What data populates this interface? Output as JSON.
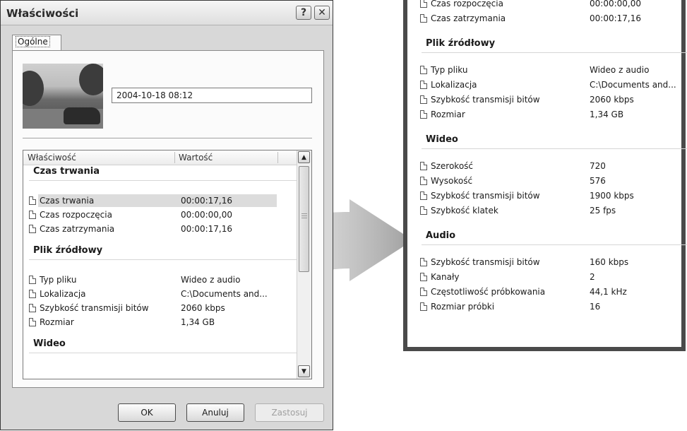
{
  "dialog": {
    "title": "Właściwości",
    "help_label": "?",
    "close_label": "✕",
    "tab_label": "Ogólne",
    "date": "2004-10-18 08:12",
    "columns": {
      "property": "Właściwość",
      "value": "Wartość"
    },
    "sections": [
      {
        "title": "Czas trwania",
        "rows": [
          {
            "k": "Czas trwania",
            "v": "00:00:17,16"
          },
          {
            "k": "Czas rozpoczęcia",
            "v": "00:00:00,00"
          },
          {
            "k": "Czas zatrzymania",
            "v": "00:00:17,16"
          }
        ]
      },
      {
        "title": "Plik źródłowy",
        "rows": [
          {
            "k": "Typ pliku",
            "v": "Wideo z audio"
          },
          {
            "k": "Lokalizacja",
            "v": "C:\\Documents and..."
          },
          {
            "k": "Szybkość transmisji bitów",
            "v": "2060 kbps"
          },
          {
            "k": "Rozmiar",
            "v": "1,34 GB"
          }
        ]
      },
      {
        "title": "Wideo",
        "rows": []
      }
    ],
    "buttons": {
      "ok": "OK",
      "cancel": "Anuluj",
      "apply": "Zastosuj"
    }
  },
  "continuation": {
    "top_rows": [
      {
        "k": "Czas rozpoczęcia",
        "v": "00:00:00,00"
      },
      {
        "k": "Czas zatrzymania",
        "v": "00:00:17,16"
      }
    ],
    "sections": [
      {
        "title": "Plik źródłowy",
        "rows": [
          {
            "k": "Typ pliku",
            "v": "Wideo z audio"
          },
          {
            "k": "Lokalizacja",
            "v": "C:\\Documents and..."
          },
          {
            "k": "Szybkość transmisji bitów",
            "v": "2060 kbps"
          },
          {
            "k": "Rozmiar",
            "v": "1,34 GB"
          }
        ]
      },
      {
        "title": "Wideo",
        "rows": [
          {
            "k": "Szerokość",
            "v": "720"
          },
          {
            "k": "Wysokość",
            "v": "576"
          },
          {
            "k": "Szybkość transmisji bitów",
            "v": "1900 kbps"
          },
          {
            "k": "Szybkość klatek",
            "v": "25 fps"
          }
        ]
      },
      {
        "title": "Audio",
        "rows": [
          {
            "k": "Szybkość transmisji bitów",
            "v": "160 kbps"
          },
          {
            "k": "Kanały",
            "v": "2"
          },
          {
            "k": "Częstotliwość próbkowania",
            "v": "44,1 kHz"
          },
          {
            "k": "Rozmiar próbki",
            "v": "16"
          }
        ]
      }
    ]
  },
  "colors": {
    "frame": "#4a4a4a",
    "arrow": "#b8b8b8",
    "highlight": "#dcdcdc"
  }
}
